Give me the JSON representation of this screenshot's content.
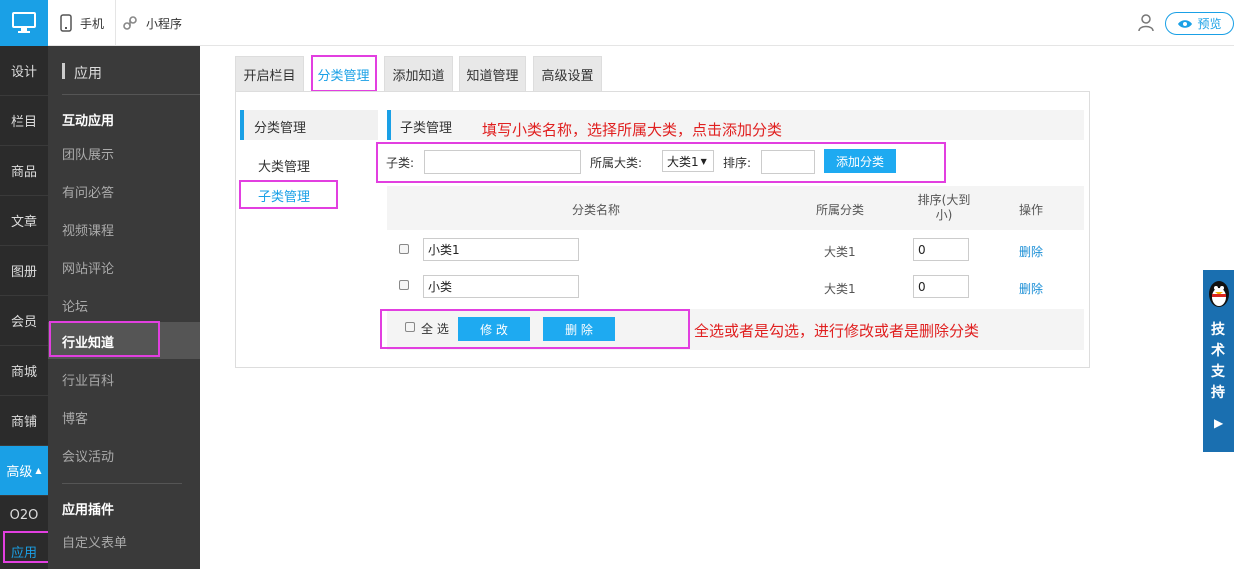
{
  "topbar": {
    "mobile": "手机",
    "miniapp": "小程序",
    "preview": "预览"
  },
  "nav_primary": [
    "设计",
    "栏目",
    "商品",
    "文章",
    "图册",
    "会员",
    "商城",
    "商铺",
    "高级",
    "O2O",
    "应用"
  ],
  "nav_secondary": {
    "title": "应用",
    "group1": "互动应用",
    "items": [
      "团队展示",
      "有问必答",
      "视频课程",
      "网站评论",
      "论坛",
      "行业知道",
      "行业百科",
      "博客",
      "会议活动"
    ],
    "group2": "应用插件",
    "item_last": "自定义表单"
  },
  "tabs": [
    "开启栏目",
    "分类管理",
    "添加知道",
    "知道管理",
    "高级设置"
  ],
  "side_menu": {
    "title": "分类管理",
    "items": [
      "大类管理",
      "子类管理"
    ]
  },
  "section_title": "子类管理",
  "annotation_top": "填写小类名称，选择所属大类，点击添加分类",
  "annotation_bottom": "全选或者是勾选，进行修改或者是删除分类",
  "form": {
    "sub_label": "子类:",
    "parent_label": "所属大类:",
    "parent_value": "大类1",
    "sort_label": "排序:",
    "add_button": "添加分类"
  },
  "table": {
    "headers": [
      "分类名称",
      "所属分类",
      "排序(大到小)",
      "操作"
    ],
    "rows": [
      {
        "name": "小类1",
        "parent": "大类1",
        "sort": "0",
        "action": "删除"
      },
      {
        "name": "小类",
        "parent": "大类1",
        "sort": "0",
        "action": "删除"
      }
    ]
  },
  "bottom": {
    "select_all": "全 选",
    "modify": "修 改",
    "delete": "删 除"
  },
  "support": "技术支持",
  "colors": {
    "accent": "#1aa0e6",
    "highlight": "#e23fe0",
    "annotation": "#e02020"
  }
}
